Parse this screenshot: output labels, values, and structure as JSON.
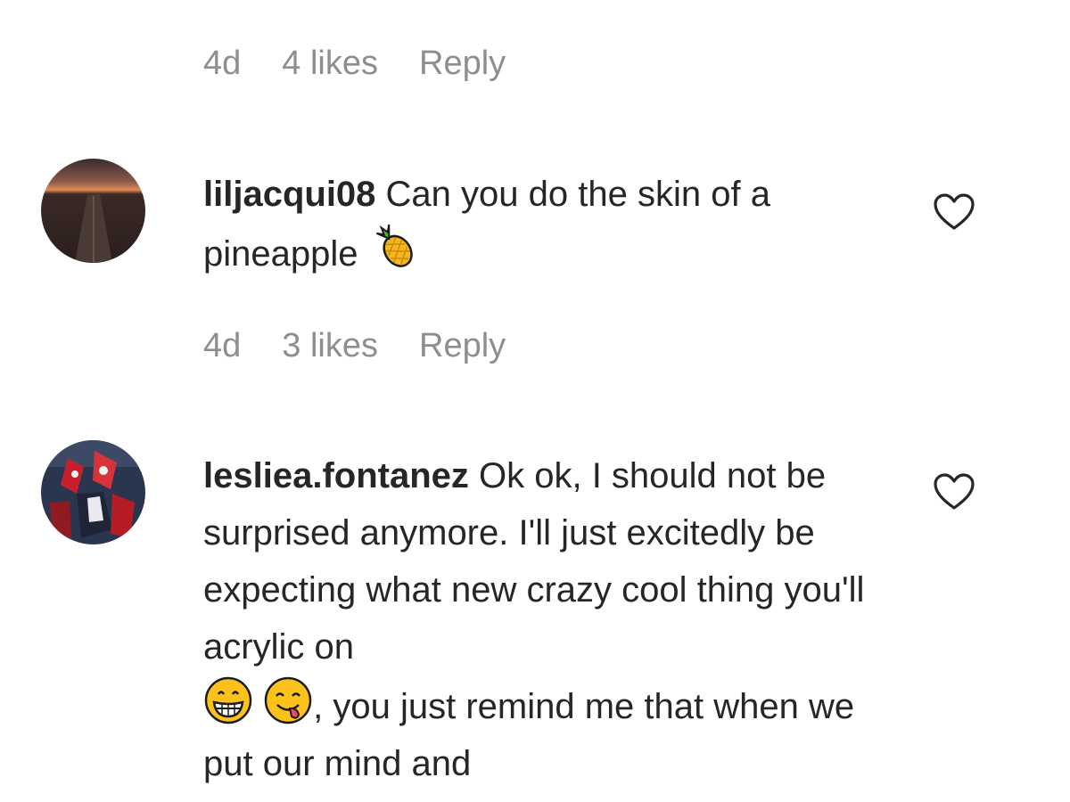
{
  "comments_above": {
    "meta": {
      "age": "4d",
      "likes": "4 likes",
      "reply_label": "Reply"
    }
  },
  "comments": [
    {
      "username": "liljacqui08",
      "text_parts": [
        "Can you do the skin of a pineapple"
      ],
      "emojis": [
        "pineapple"
      ],
      "avatar_icon": "sunset-road-avatar",
      "like_icon": "heart-outline-icon",
      "meta": {
        "age": "4d",
        "likes": "3 likes",
        "reply_label": "Reply"
      }
    },
    {
      "username": "lesliea.fontanez",
      "text_parts": [
        "Ok ok, I should not be surprised anymore. I'll just excitedly be expecting what new crazy cool thing you'll acrylic on",
        ", you just remind me that when we put our mind and"
      ],
      "emojis": [
        "grinning-face",
        "face-savoring-food"
      ],
      "avatar_icon": "spider-costume-avatar",
      "like_icon": "heart-outline-icon"
    }
  ],
  "colors": {
    "text_primary": "#262626",
    "text_secondary": "#8e8e8e",
    "background": "#ffffff"
  }
}
